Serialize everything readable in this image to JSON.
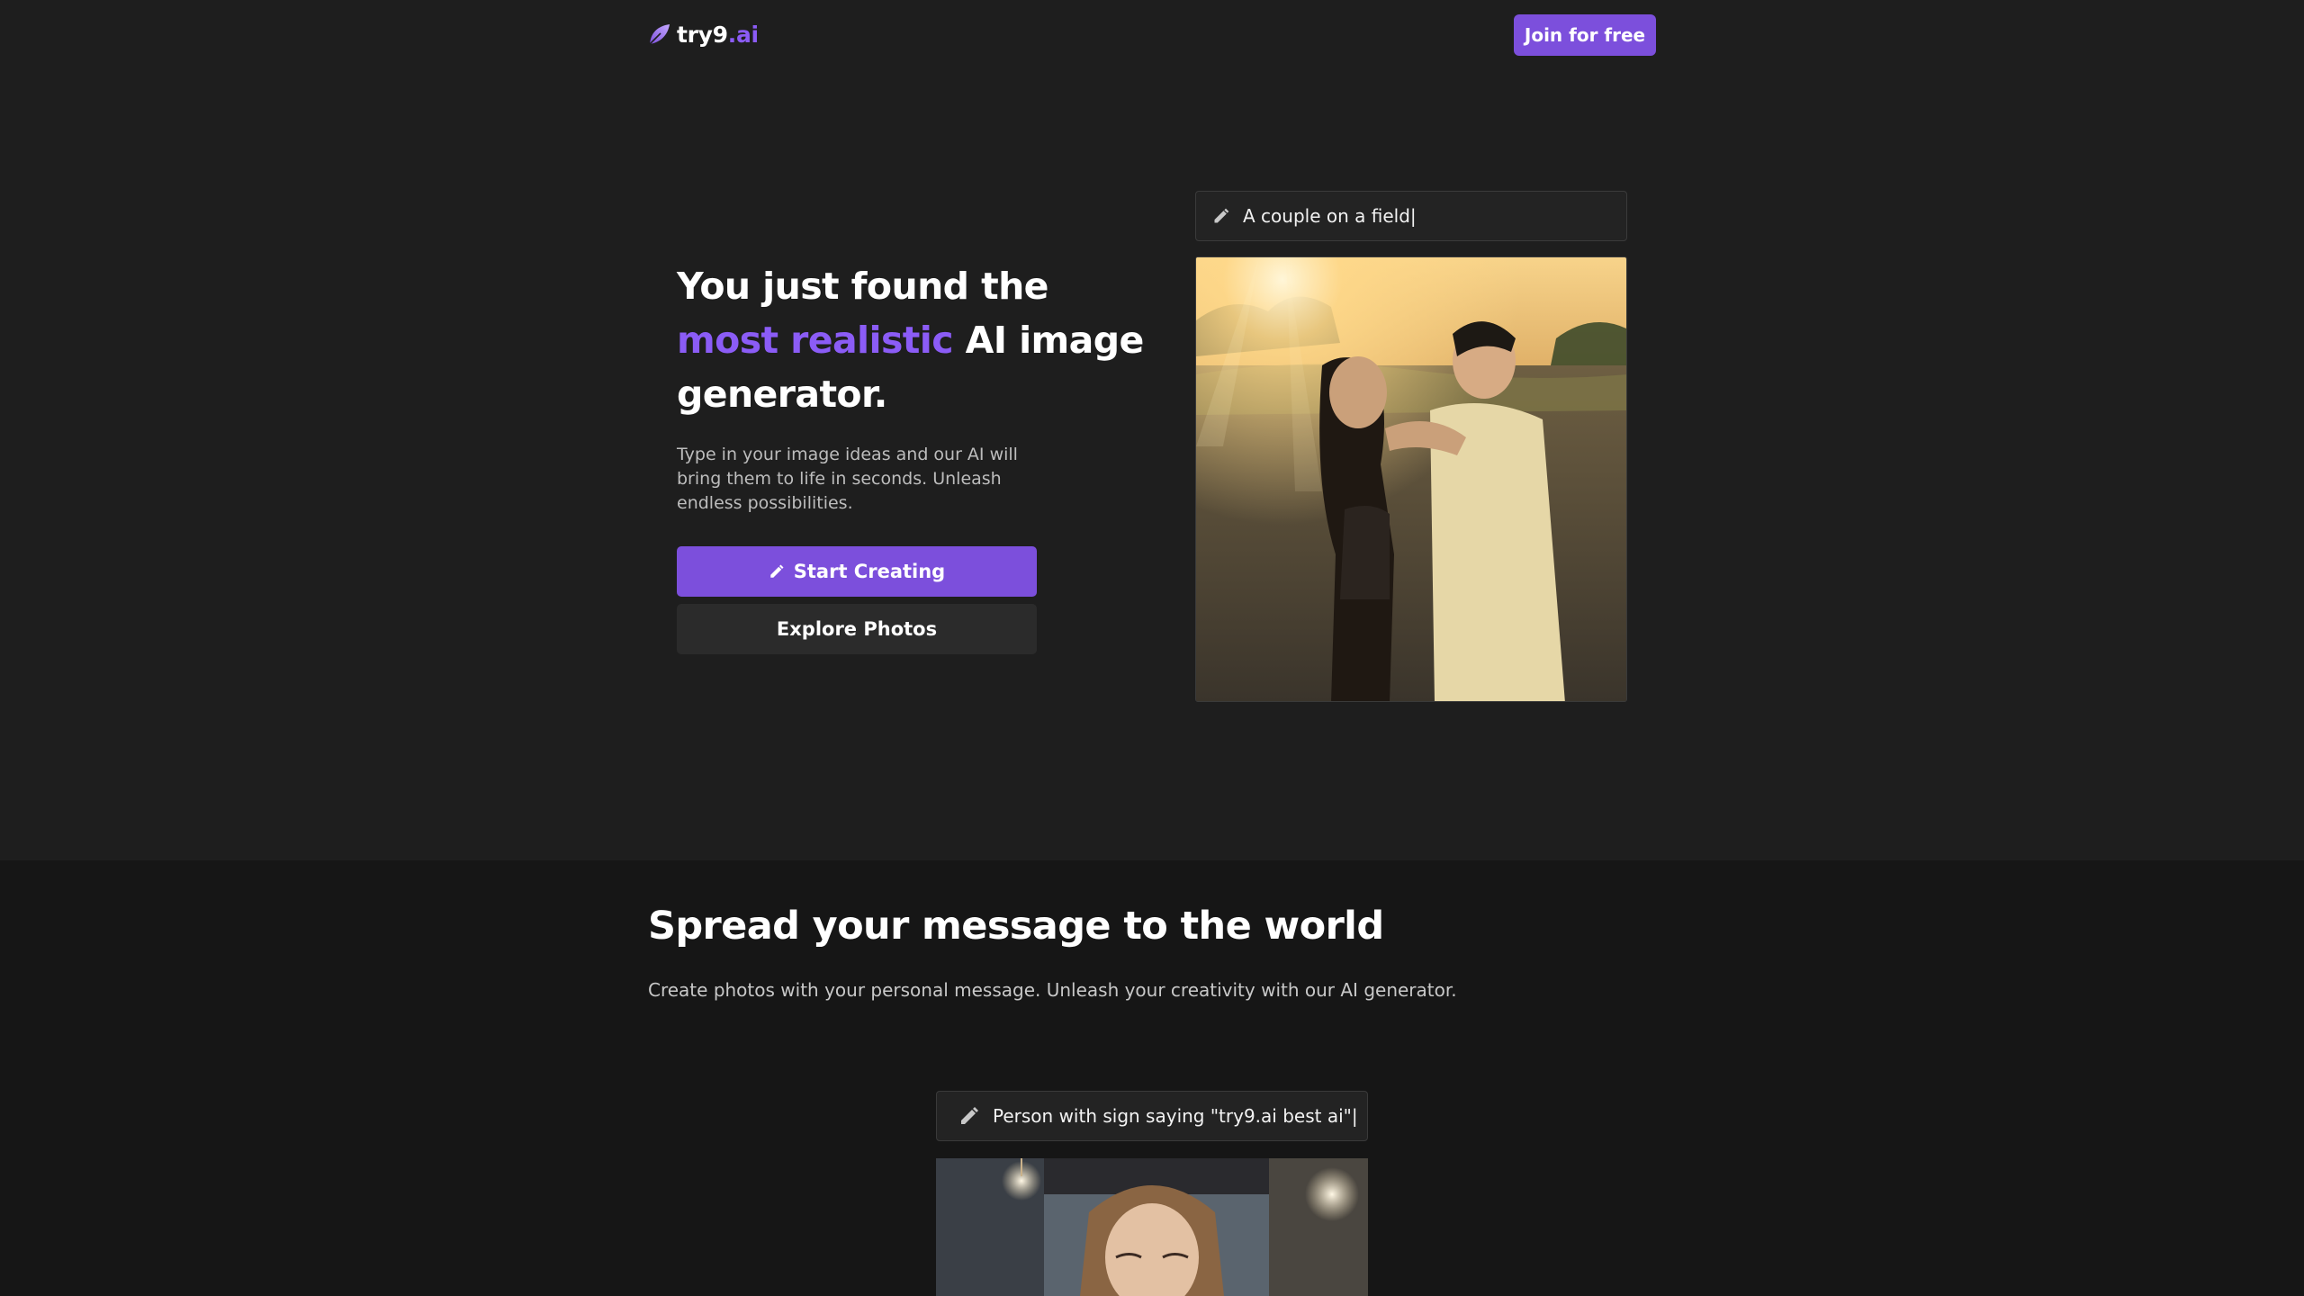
{
  "header": {
    "logo_main": "try9",
    "logo_accent": ".ai",
    "join_label": "Join for free"
  },
  "hero": {
    "title_line1": "You just found the",
    "title_highlight": "most realistic",
    "title_rest": "AI image",
    "title_line3": "generator.",
    "description": "Type in your image ideas and our AI will bring them to life in seconds. Unleash endless possibilities.",
    "primary_button": "Start Creating",
    "secondary_button": "Explore Photos",
    "prompt": "A couple on a field|"
  },
  "section2": {
    "title": "Spread your message to the world",
    "description": "Create photos with your personal message. Unleash your creativity with our AI generator.",
    "prompt": "Person with sign saying \"try9.ai best ai\"|"
  },
  "icons": {
    "logo": "leaf-logo-icon",
    "pen": "pencil-icon"
  },
  "colors": {
    "accent": "#7c4fdc",
    "accent_text": "#8b5cf6",
    "background": "#1e1e1e",
    "section_background": "#161616"
  }
}
